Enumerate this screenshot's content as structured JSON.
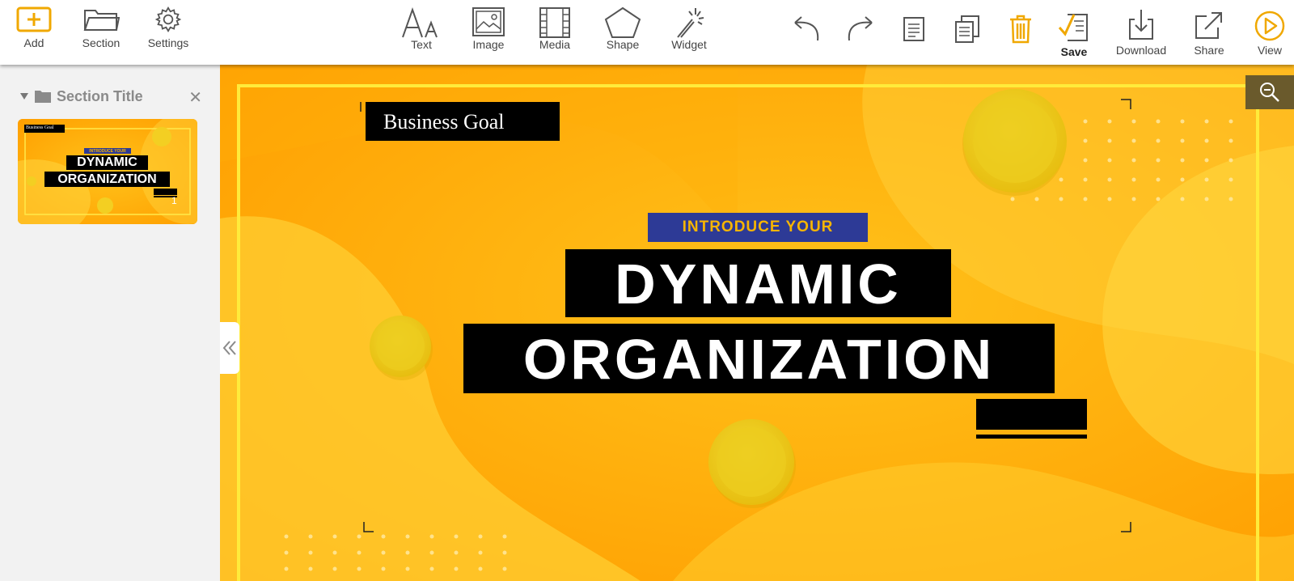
{
  "toolbar": {
    "add": "Add",
    "section": "Section",
    "settings": "Settings",
    "text": "Text",
    "image": "Image",
    "media": "Media",
    "shape": "Shape",
    "widget": "Widget",
    "save": "Save",
    "download": "Download",
    "share": "Share",
    "view": "View"
  },
  "icons": {
    "add": "plus-square-icon",
    "section": "folder-icon",
    "settings": "gear-icon",
    "text": "text-aa-icon",
    "image": "image-icon",
    "media": "film-strip-icon",
    "shape": "pentagon-icon",
    "widget": "magic-wand-icon",
    "undo": "undo-icon",
    "redo": "redo-icon",
    "page": "page-icon",
    "duplicate": "duplicate-icon",
    "delete": "trash-icon",
    "save": "save-check-icon",
    "download": "download-icon",
    "share": "share-icon",
    "view": "play-circle-icon",
    "zoom": "zoom-out-icon",
    "collapse": "double-chevron-left-icon"
  },
  "colors": {
    "accent": "#f0a800",
    "canvas_bg": "#ffb800",
    "intro_bg": "#2d3a96",
    "intro_text": "#f7b500"
  },
  "sidebar": {
    "section_title": "Section Title",
    "close_label": "✕",
    "thumbnail": {
      "business_goal": "Business Goal",
      "intro": "INTRODUCE YOUR",
      "line1": "DYNAMIC",
      "line2": "ORGANIZATION",
      "page_number": "1"
    }
  },
  "slide": {
    "business_goal": "Business Goal",
    "intro": "INTRODUCE YOUR",
    "line1": "DYNAMIC",
    "line2": "ORGANIZATION"
  }
}
